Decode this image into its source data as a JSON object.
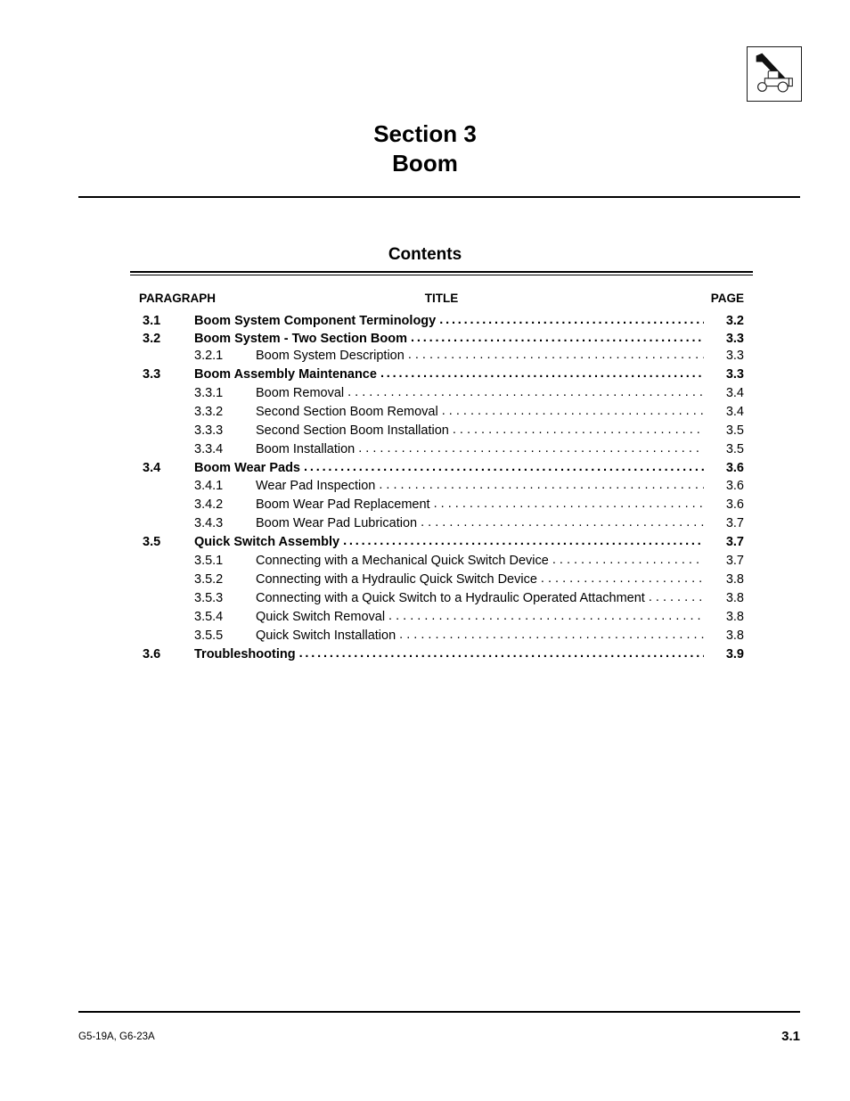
{
  "header": {
    "icon_name": "telehandler-boom-icon"
  },
  "section": {
    "number_line": "Section 3",
    "name_line": "Boom"
  },
  "contents": {
    "heading": "Contents",
    "columns": {
      "paragraph": "PARAGRAPH",
      "title": "TITLE",
      "page": "PAGE"
    },
    "entries": [
      {
        "level": 1,
        "number": "3.1",
        "title": "Boom System Component Terminology",
        "page": "3.2",
        "leader": true
      },
      {
        "level": 1,
        "number": "3.2",
        "title": "Boom System - Two Section Boom",
        "page": "3.3",
        "leader": true
      },
      {
        "level": 2,
        "number": "3.2.1",
        "title": "Boom System Description",
        "page": "3.3",
        "leader": true
      },
      {
        "level": 1,
        "number": "3.3",
        "title": "Boom Assembly Maintenance",
        "page": "3.3",
        "leader": true
      },
      {
        "level": 2,
        "number": "3.3.1",
        "title": "Boom Removal",
        "page": "3.4",
        "leader": true
      },
      {
        "level": 2,
        "number": "3.3.2",
        "title": "Second Section Boom Removal",
        "page": "3.4",
        "leader": true
      },
      {
        "level": 2,
        "number": "3.3.3",
        "title": "Second Section Boom Installation",
        "page": "3.5",
        "leader": true
      },
      {
        "level": 2,
        "number": "3.3.4",
        "title": "Boom Installation",
        "page": "3.5",
        "leader": true
      },
      {
        "level": 1,
        "number": "3.4",
        "title": "Boom Wear Pads",
        "page": "3.6",
        "leader": true
      },
      {
        "level": 2,
        "number": "3.4.1",
        "title": "Wear Pad Inspection",
        "page": "3.6",
        "leader": true
      },
      {
        "level": 2,
        "number": "3.4.2",
        "title": "Boom Wear Pad Replacement",
        "page": "3.6",
        "leader": true
      },
      {
        "level": 2,
        "number": "3.4.3",
        "title": "Boom Wear Pad Lubrication",
        "page": "3.7",
        "leader": true
      },
      {
        "level": 1,
        "number": "3.5",
        "title": "Quick Switch Assembly",
        "page": "3.7",
        "leader": true
      },
      {
        "level": 2,
        "number": "3.5.1",
        "title": "Connecting with a Mechanical Quick Switch Device",
        "page": "3.7",
        "leader": true
      },
      {
        "level": 2,
        "number": "3.5.2",
        "title": "Connecting with a Hydraulic Quick Switch Device",
        "page": "3.8",
        "leader": true
      },
      {
        "level": 2,
        "number": "3.5.3",
        "title": "Connecting with a Quick Switch to a Hydraulic Operated Attachment",
        "page": "3.8",
        "leader": true
      },
      {
        "level": 2,
        "number": "3.5.4",
        "title": "Quick Switch Removal",
        "page": "3.8",
        "leader": true
      },
      {
        "level": 2,
        "number": "3.5.5",
        "title": "Quick Switch Installation",
        "page": "3.8",
        "leader": true
      },
      {
        "level": 1,
        "number": "3.6",
        "title": "Troubleshooting",
        "page": "3.9",
        "leader": true
      }
    ]
  },
  "footer": {
    "doc_code": "G5-19A, G6-23A",
    "page_folio": "3.1"
  }
}
